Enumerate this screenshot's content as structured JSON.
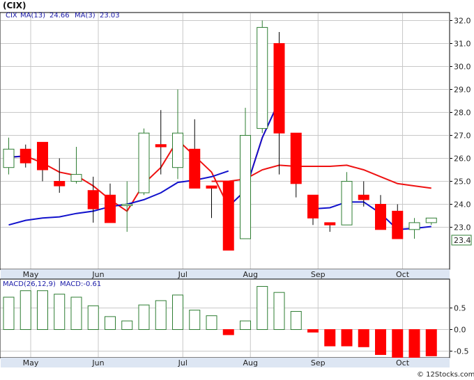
{
  "title": "(CIX)",
  "credit": "© 12Stocks.com",
  "price_panel": {
    "ticker": "CIX",
    "ma13_label": "MA(13)",
    "ma13_value": "24.66",
    "ma3_label": "MA(3)",
    "ma3_value": "23.03",
    "last_price_label": "23.4"
  },
  "macd_panel": {
    "label": "MACD(26,12,9)",
    "value_label": "MACD:-0.61"
  },
  "colors": {
    "up": "#2e7d32",
    "down": "#ff0000",
    "ma13": "#ee1111",
    "ma3": "#1111cc",
    "grid": "#c8c8c8",
    "frame": "#000000",
    "panel_bg": "#ffffff",
    "axis_strip": "#dde6f3"
  },
  "chart_data": [
    {
      "type": "candlestick",
      "ylim": [
        22.0,
        32.2
      ],
      "yticks": [
        "23.0",
        "24.0",
        "25.0",
        "26.0",
        "27.0",
        "28.0",
        "29.0",
        "30.0",
        "31.0",
        "32.0"
      ],
      "ytick_values": [
        23,
        24,
        25,
        26,
        27,
        28,
        29,
        30,
        31,
        32
      ],
      "months": [
        "May",
        "Jun",
        "Jul",
        "Aug",
        "Sep",
        "Oct"
      ],
      "month_bar_index": [
        1.3,
        5.3,
        10.3,
        14.3,
        18.3,
        23.3
      ],
      "grid": true,
      "candles": [
        {
          "o": 25.6,
          "h": 26.9,
          "l": 25.3,
          "c": 26.4
        },
        {
          "o": 26.4,
          "h": 26.6,
          "l": 25.6,
          "c": 25.8
        },
        {
          "o": 26.7,
          "h": 26.7,
          "l": 25.0,
          "c": 25.5
        },
        {
          "o": 25.0,
          "h": 26.0,
          "l": 24.5,
          "c": 24.8
        },
        {
          "o": 25.0,
          "h": 26.5,
          "l": 24.9,
          "c": 25.3
        },
        {
          "o": 24.6,
          "h": 25.2,
          "l": 23.2,
          "c": 23.8
        },
        {
          "o": 24.4,
          "h": 24.9,
          "l": 23.2,
          "c": 23.2
        },
        {
          "o": 24.0,
          "h": 25.0,
          "l": 22.8,
          "c": 24.0
        },
        {
          "o": 24.5,
          "h": 27.3,
          "l": 24.4,
          "c": 27.1
        },
        {
          "o": 26.6,
          "h": 28.1,
          "l": 25.3,
          "c": 26.5
        },
        {
          "o": 25.6,
          "h": 29.0,
          "l": 25.1,
          "c": 27.1
        },
        {
          "o": 26.4,
          "h": 27.7,
          "l": 24.7,
          "c": 24.7
        },
        {
          "o": 24.8,
          "h": 24.8,
          "l": 23.4,
          "c": 24.7
        },
        {
          "o": 25.0,
          "h": 25.0,
          "l": 22.0,
          "c": 22.0
        },
        {
          "o": 22.5,
          "h": 28.2,
          "l": 22.5,
          "c": 27.0
        },
        {
          "o": 27.3,
          "h": 32.0,
          "l": 27.1,
          "c": 31.7
        },
        {
          "o": 31.0,
          "h": 31.5,
          "l": 25.3,
          "c": 27.1
        },
        {
          "o": 27.1,
          "h": 27.1,
          "l": 24.3,
          "c": 24.9
        },
        {
          "o": 24.4,
          "h": 24.4,
          "l": 23.1,
          "c": 23.4
        },
        {
          "o": 23.2,
          "h": 23.2,
          "l": 22.8,
          "c": 23.1
        },
        {
          "o": 23.1,
          "h": 25.4,
          "l": 23.1,
          "c": 25.0
        },
        {
          "o": 24.4,
          "h": 25.0,
          "l": 23.9,
          "c": 24.2
        },
        {
          "o": 24.0,
          "h": 24.4,
          "l": 22.9,
          "c": 22.9
        },
        {
          "o": 23.7,
          "h": 24.0,
          "l": 22.5,
          "c": 22.5
        },
        {
          "o": 22.9,
          "h": 23.4,
          "l": 22.5,
          "c": 23.2
        },
        {
          "o": 23.2,
          "h": 23.4,
          "l": 23.1,
          "c": 23.4
        }
      ],
      "ma13_series": [
        {
          "i": 12,
          "v": 25.0
        },
        {
          "i": 13,
          "v": 25.0
        },
        {
          "i": 14,
          "v": 25.1
        },
        {
          "i": 15,
          "v": 25.5
        },
        {
          "i": 16,
          "v": 25.7
        },
        {
          "i": 17,
          "v": 25.65
        },
        {
          "i": 18,
          "v": 25.65
        },
        {
          "i": 19,
          "v": 25.65
        },
        {
          "i": 20,
          "v": 25.7
        },
        {
          "i": 21,
          "v": 25.5
        },
        {
          "i": 22,
          "v": 25.2
        },
        {
          "i": 23,
          "v": 24.9
        },
        {
          "i": 24,
          "v": 24.8
        },
        {
          "i": 25,
          "v": 24.7
        }
      ],
      "ma3_series": [
        {
          "i": 0,
          "v": 26.05
        },
        {
          "i": 1,
          "v": 26.1
        },
        {
          "i": 2,
          "v": 25.8
        },
        {
          "i": 3,
          "v": 25.4
        },
        {
          "i": 4,
          "v": 25.25
        },
        {
          "i": 5,
          "v": 24.8
        },
        {
          "i": 6,
          "v": 24.2
        },
        {
          "i": 7,
          "v": 23.7
        },
        {
          "i": 8,
          "v": 24.9
        },
        {
          "i": 9,
          "v": 25.6
        },
        {
          "i": 10,
          "v": 26.8
        },
        {
          "i": 11,
          "v": 26.1
        },
        {
          "i": 12,
          "v": 25.4
        },
        {
          "i": 13,
          "v": 23.9
        },
        {
          "i": 14,
          "v": 24.6
        },
        {
          "i": 15,
          "v": 26.9
        },
        {
          "i": 16,
          "v": 28.5
        }
      ],
      "ma3_series_b": [
        {
          "i": 0,
          "v": 23.1
        },
        {
          "i": 1,
          "v": 23.3
        },
        {
          "i": 2,
          "v": 23.4
        },
        {
          "i": 3,
          "v": 23.45
        },
        {
          "i": 4,
          "v": 23.6
        },
        {
          "i": 5,
          "v": 23.7
        },
        {
          "i": 6,
          "v": 23.9
        },
        {
          "i": 7,
          "v": 24.0
        },
        {
          "i": 8,
          "v": 24.2
        },
        {
          "i": 9,
          "v": 24.5
        },
        {
          "i": 10,
          "v": 24.95
        },
        {
          "i": 11,
          "v": 25.05
        },
        {
          "i": 12,
          "v": 25.2
        },
        {
          "i": 13,
          "v": 25.45
        },
        {
          "i": 18,
          "v": 23.8
        },
        {
          "i": 19,
          "v": 23.85
        },
        {
          "i": 20,
          "v": 24.1
        },
        {
          "i": 21,
          "v": 24.1
        },
        {
          "i": 22,
          "v": 23.6
        },
        {
          "i": 23,
          "v": 22.9
        },
        {
          "i": 24,
          "v": 22.95
        },
        {
          "i": 25,
          "v": 23.03
        }
      ]
    },
    {
      "type": "bar",
      "title": "MACD(26,12,9)",
      "ylim": [
        -0.75,
        1.05
      ],
      "yticks": [
        "0.5",
        "0.0",
        "-0.5"
      ],
      "ytick_values": [
        0.5,
        0.0,
        -0.5
      ],
      "grid": true,
      "values": [
        0.75,
        0.9,
        0.9,
        0.82,
        0.75,
        0.55,
        0.3,
        0.2,
        0.57,
        0.67,
        0.8,
        0.45,
        0.32,
        -0.12,
        0.2,
        1.0,
        0.86,
        0.42,
        -0.06,
        -0.38,
        -0.38,
        -0.4,
        -0.58,
        -0.7,
        -0.68,
        -0.61
      ]
    }
  ]
}
